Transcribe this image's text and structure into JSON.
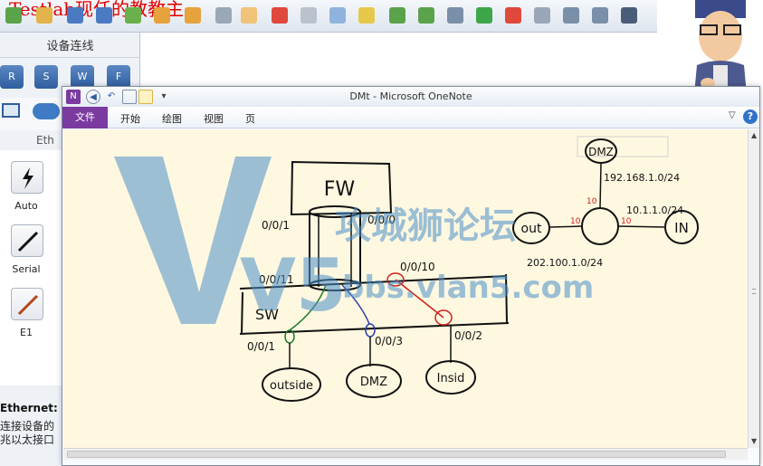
{
  "bg_app": {
    "title": "Testlab现任的教教主",
    "sidebar_header": "设备连线",
    "device_icons": [
      "R",
      "S",
      "W",
      "F"
    ],
    "eth_tab": "Eth",
    "cables": [
      {
        "label": "Auto"
      },
      {
        "label": "Serial"
      },
      {
        "label": "E1"
      }
    ],
    "info_title": "Ethernet:",
    "info_text": "连接设备的兆以太接口"
  },
  "onenote": {
    "window_title": "DMt - Microsoft OneNote",
    "app_badge": "N",
    "ribbon_tabs": [
      "文件",
      "开始",
      "绘图",
      "视图",
      "页"
    ]
  },
  "drawing": {
    "fw_label": "FW",
    "sw_label": "SW",
    "ports": {
      "fw_left": "0/0/1",
      "fw_right": "0/0/0",
      "sw_p11": "0/0/11",
      "sw_p10": "0/0/10",
      "sw_p1": "0/0/1",
      "sw_p3": "0/0/3",
      "sw_p2": "0/0/2"
    },
    "hosts": {
      "outside": "outside",
      "dmz": "DMZ",
      "inside": "Insid"
    },
    "topology": {
      "dmz": "DMZ",
      "out": "out",
      "in": "IN",
      "net_dmz": "192.168.1.0/24",
      "net_in": "10.1.1.0/24",
      "net_out": "202.100.1.0/24",
      "mark_dmz": "10",
      "mark_out": "10",
      "mark_in": "10"
    },
    "link_colors": {
      "green": "#1e7a2e",
      "blue": "#2a3fa8",
      "red": "#d0201b"
    }
  },
  "watermark": {
    "logo_text": "V5",
    "cn_text": "攻城狮论坛",
    "url_text": "bbs.vlan5.com",
    "color": "#4a90c9"
  }
}
